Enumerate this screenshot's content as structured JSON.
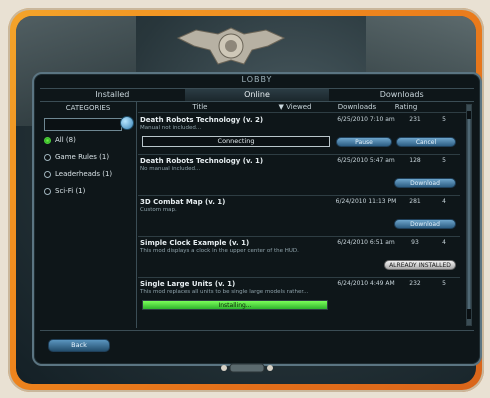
{
  "window": {
    "title": "LOBBY"
  },
  "tabs": [
    {
      "label": "Installed",
      "active": false
    },
    {
      "label": "Online",
      "active": true
    },
    {
      "label": "Downloads",
      "active": false
    }
  ],
  "sidebar": {
    "title": "CATEGORIES",
    "search": {
      "value": "",
      "placeholder": ""
    },
    "categories": [
      {
        "label": "All (8)",
        "checked": true
      },
      {
        "label": "Game Rules (1)",
        "checked": false
      },
      {
        "label": "Leaderheads (1)",
        "checked": false
      },
      {
        "label": "Sci-Fi (1)",
        "checked": false
      }
    ]
  },
  "table": {
    "headers": {
      "title": "Title",
      "viewed": "▼ Viewed",
      "downloads": "Downloads",
      "rating": "Rating"
    },
    "rows": [
      {
        "name": "Death Robots Technology (v. 2)",
        "desc": "Manual not included...",
        "date": "6/25/2010 7:10 am",
        "downloads": "231",
        "rating": "5",
        "status": "Connecting",
        "btn1": "Pause",
        "btn2": "Cancel"
      },
      {
        "name": "Death Robots Technology (v. 1)",
        "desc": "No manual included...",
        "date": "6/25/2010 5:47 am",
        "downloads": "128",
        "rating": "5",
        "btn1": "Download"
      },
      {
        "name": "3D Combat Map (v. 1)",
        "desc": "Custom map.",
        "date": "6/24/2010 11:13 PM",
        "downloads": "281",
        "rating": "4",
        "btn1": "Download"
      },
      {
        "name": "Simple Clock Example (v. 1)",
        "desc": "This mod displays a clock in the upper center of the HUD.",
        "date": "6/24/2010 6:51 am",
        "downloads": "93",
        "rating": "4",
        "btn1": "ALREADY INSTALLED"
      },
      {
        "name": "Single Large Units (v. 1)",
        "desc": "This mod replaces all units to be single large models rather...",
        "date": "6/24/2010 4:49 AM",
        "downloads": "232",
        "rating": "5",
        "progress_label": "Installing...",
        "progress": 1.0
      }
    ]
  },
  "footer": {
    "back_label": "Back"
  }
}
